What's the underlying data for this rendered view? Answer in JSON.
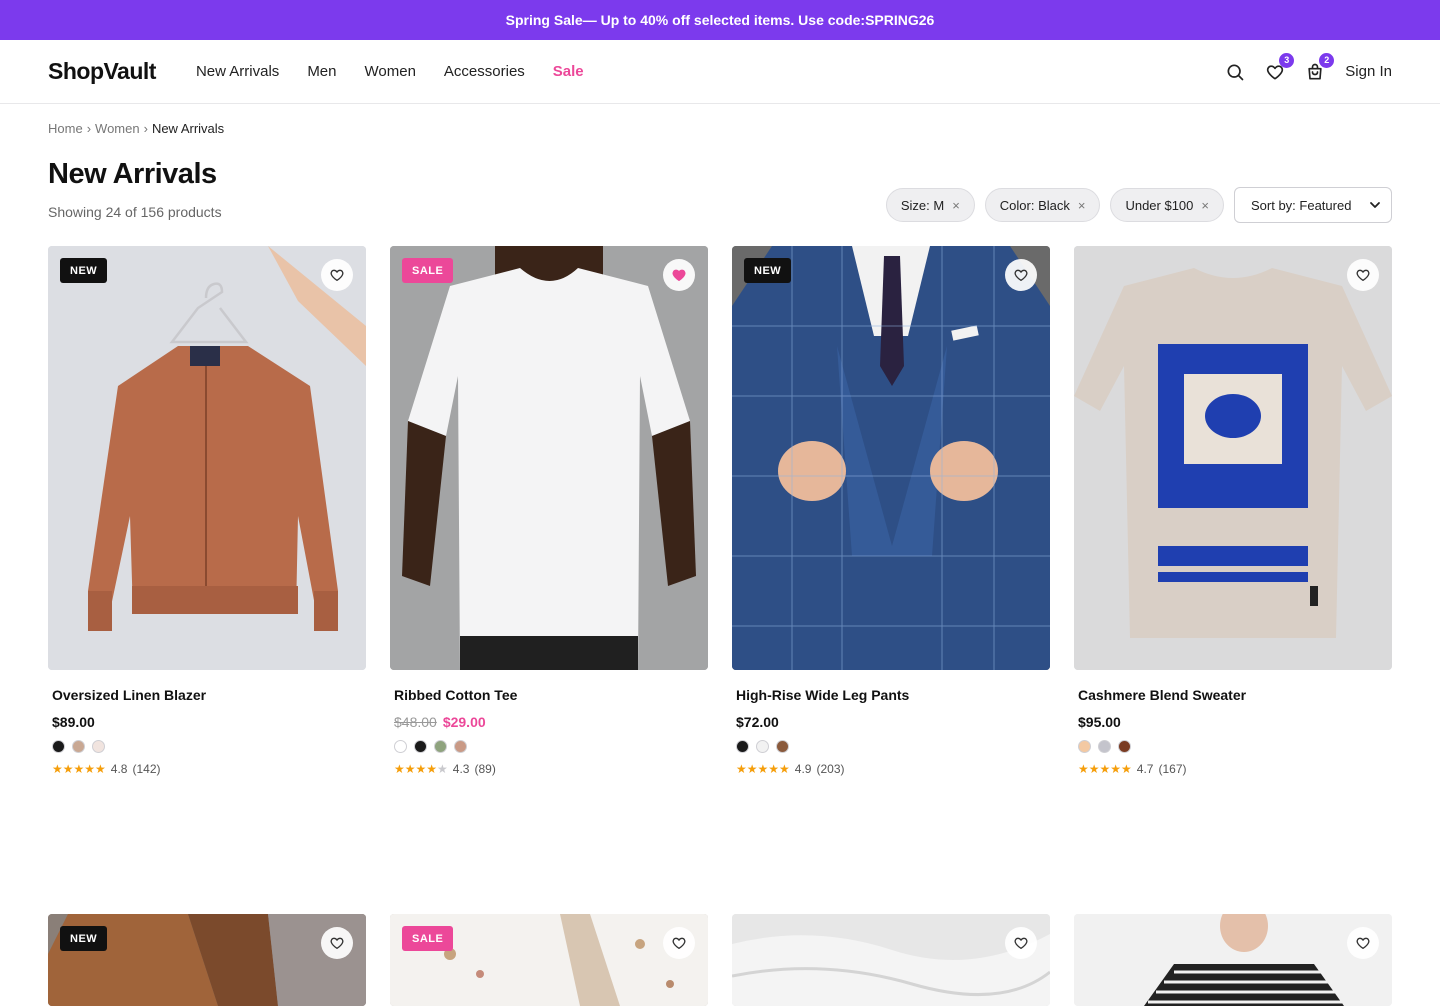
{
  "promo": {
    "prefix": "Spring Sale",
    "text": " — Up to 40% off selected items. Use code: ",
    "code": "SPRING26"
  },
  "header": {
    "logo": "ShopVault",
    "nav": [
      "New Arrivals",
      "Men",
      "Women",
      "Accessories",
      "Sale"
    ],
    "wishlist_count": "3",
    "cart_count": "2",
    "signin": "Sign In",
    "icons": [
      "search-icon",
      "heart-icon",
      "bag-icon"
    ]
  },
  "breadcrumb": {
    "home": "Home",
    "sep": "›",
    "category": "Women",
    "current": "New Arrivals"
  },
  "page": {
    "title": "New Arrivals",
    "subtitle": "Showing 24 of 156 products"
  },
  "filters": {
    "chips": [
      "Size: M",
      "Color: Black",
      "Under $100"
    ],
    "remove_glyph": "×",
    "sort_label": "Sort by: Featured"
  },
  "products": [
    {
      "name": "Oversized Linen Blazer",
      "price": "$89.00",
      "old_price": "",
      "tag": "NEW",
      "favorited": false,
      "swatches": [
        "#1a1a1a",
        "#c9a893",
        "#f1e4df"
      ],
      "stars": "★★★★★",
      "empty_stars": "",
      "rating": "4.8",
      "reviews": "(142)",
      "bg": "#d9dbe0",
      "art": "jacket"
    },
    {
      "name": "Ribbed Cotton Tee",
      "price": "$29.00",
      "old_price": "$48.00",
      "tag": "SALE",
      "favorited": true,
      "swatches": [
        "#ffffff",
        "#1a1a1a",
        "#8fa37e",
        "#c99a86"
      ],
      "stars": "★★★★",
      "empty_stars": "★",
      "rating": "4.3",
      "reviews": "(89)",
      "bg": "#a9a6a4",
      "art": "tee"
    },
    {
      "name": "High-Rise Wide Leg Pants",
      "price": "$72.00",
      "old_price": "",
      "tag": "NEW",
      "favorited": false,
      "swatches": [
        "#1a1a1a",
        "#f2f2f2",
        "#8a5a3c"
      ],
      "stars": "★★★★★",
      "empty_stars": "",
      "rating": "4.9",
      "reviews": "(203)",
      "bg": "#6b6b6b",
      "art": "suit"
    },
    {
      "name": "Cashmere Blend Sweater",
      "price": "$95.00",
      "old_price": "",
      "tag": "",
      "favorited": false,
      "swatches": [
        "#f3c9a3",
        "#c4c4cc",
        "#7a3b22"
      ],
      "stars": "★★★★★",
      "empty_stars": "",
      "rating": "4.7",
      "reviews": "(167)",
      "bg": "#dadadb",
      "art": "graphic-tee"
    },
    {
      "tag": "NEW",
      "favorited": false,
      "bg": "#9a8d82",
      "art": "coat"
    },
    {
      "tag": "SALE",
      "favorited": false,
      "bg": "#cfcac4",
      "art": "shirt"
    },
    {
      "tag": "",
      "favorited": false,
      "bg": "#e4e4e4",
      "art": "fabric"
    },
    {
      "tag": "",
      "favorited": false,
      "bg": "#f1f1f1",
      "art": "stripe"
    }
  ]
}
